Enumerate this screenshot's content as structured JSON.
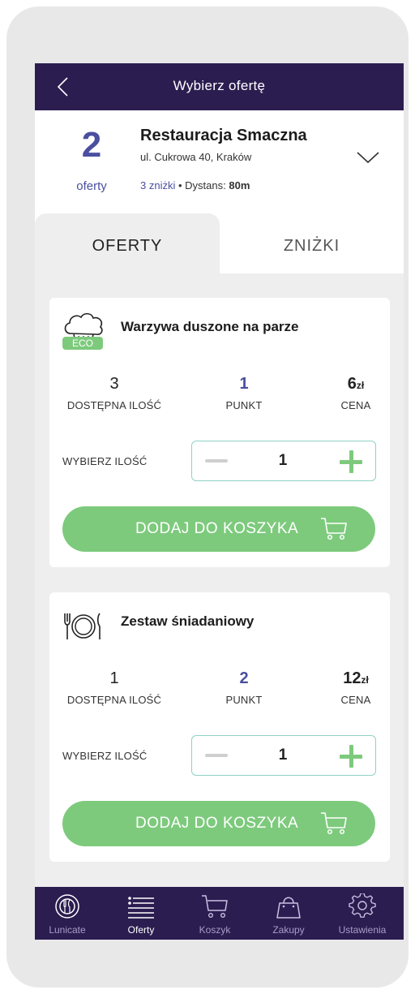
{
  "header": {
    "title": "Wybierz ofertę"
  },
  "restaurant": {
    "offer_count": "2",
    "offer_count_label": "oferty",
    "name": "Restauracja Smaczna",
    "address": "ul. Cukrowa 40, Kraków",
    "discounts": "3 zniżki",
    "separator": "•",
    "distance_label": "Dystans:",
    "distance_value": "80m"
  },
  "tabs": [
    {
      "label": "OFERTY",
      "active": true
    },
    {
      "label": "ZNIŻKI",
      "active": false
    }
  ],
  "offers": [
    {
      "name": "Warzywa duszone na parze",
      "icon": "cloud-chef-hat-icon",
      "badge": "ECO",
      "available": "3",
      "available_label": "DOSTĘPNA ILOŚĆ",
      "point": "1",
      "point_label": "PUNKT",
      "price": "6",
      "currency": "zł",
      "price_label": "CENA",
      "choose_label": "WYBIERZ ILOŚĆ",
      "quantity": "1",
      "add_label": "DODAJ DO KOSZYKA"
    },
    {
      "name": "Zestaw śniadaniowy",
      "icon": "plate-cutlery-icon",
      "available": "1",
      "available_label": "DOSTĘPNA ILOŚĆ",
      "point": "2",
      "point_label": "PUNKT",
      "price": "12",
      "currency": "zł",
      "price_label": "CENA",
      "choose_label": "WYBIERZ ILOŚĆ",
      "quantity": "1",
      "add_label": "DODAJ DO KOSZYKA"
    }
  ],
  "nav": [
    {
      "label": "Lunicate",
      "icon": "lunicate-logo-icon",
      "active": false
    },
    {
      "label": "Oferty",
      "icon": "list-icon",
      "active": true
    },
    {
      "label": "Koszyk",
      "icon": "cart-icon",
      "active": false
    },
    {
      "label": "Zakupy",
      "icon": "shopping-bag-icon",
      "active": false
    },
    {
      "label": "Ustawienia",
      "icon": "gear-icon",
      "active": false
    }
  ],
  "colors": {
    "header_bg": "#2b1d50",
    "accent_blue": "#4a4fa0",
    "green": "#7dca7d",
    "stepper_border": "#8fd1c5"
  }
}
